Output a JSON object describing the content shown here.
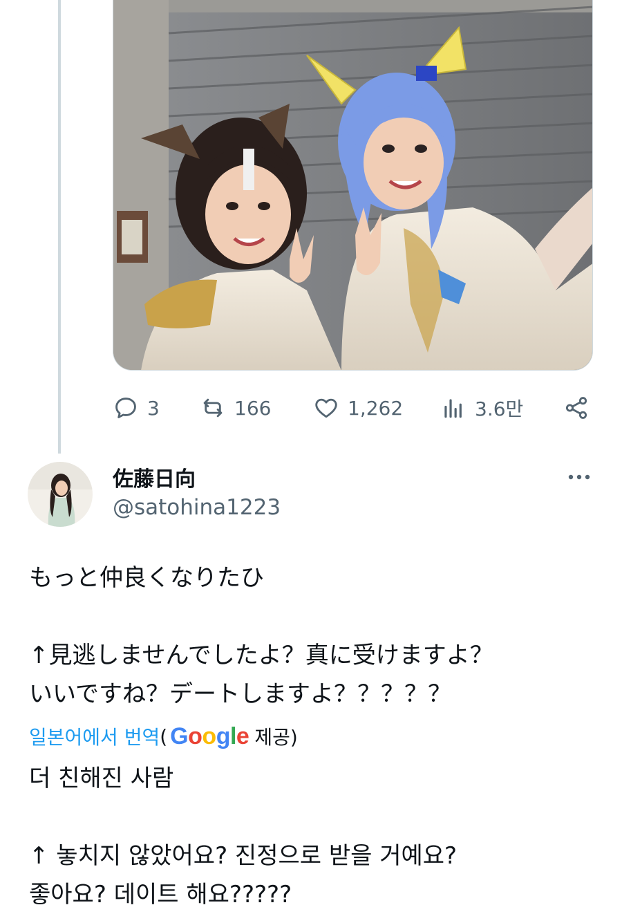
{
  "thread": {
    "media_alt": "Two cosplayers with horse ears posing with peace signs",
    "stats": {
      "replies": "3",
      "reposts": "166",
      "likes": "1,262",
      "views": "3.6만"
    }
  },
  "tweet": {
    "display_name": "佐藤日向",
    "handle": "@satohina1223",
    "text_lines": [
      "もっと仲良くなりたひ",
      "",
      "↑見逃しませんでしたよ？真に受けますよ？",
      "いいですね？デートしますよ？？？？？"
    ],
    "translate": {
      "link_label": "일본어에서 번역",
      "open_paren": "(",
      "provider": "Google",
      "provided_label": " 제공)"
    },
    "translated_lines": [
      "더 친해진 사람",
      "",
      "↑ 놓치지 않았어요? 진정으로 받을 거예요?",
      "좋아요? 데이트 해요?????"
    ]
  },
  "colors": {
    "accent": "#1d9bf0",
    "text_primary": "#0f1419",
    "text_secondary": "#536471",
    "border": "#cfd9de"
  },
  "icons": [
    "reply-icon",
    "repost-icon",
    "like-icon",
    "views-icon",
    "share-icon",
    "more-icon"
  ]
}
